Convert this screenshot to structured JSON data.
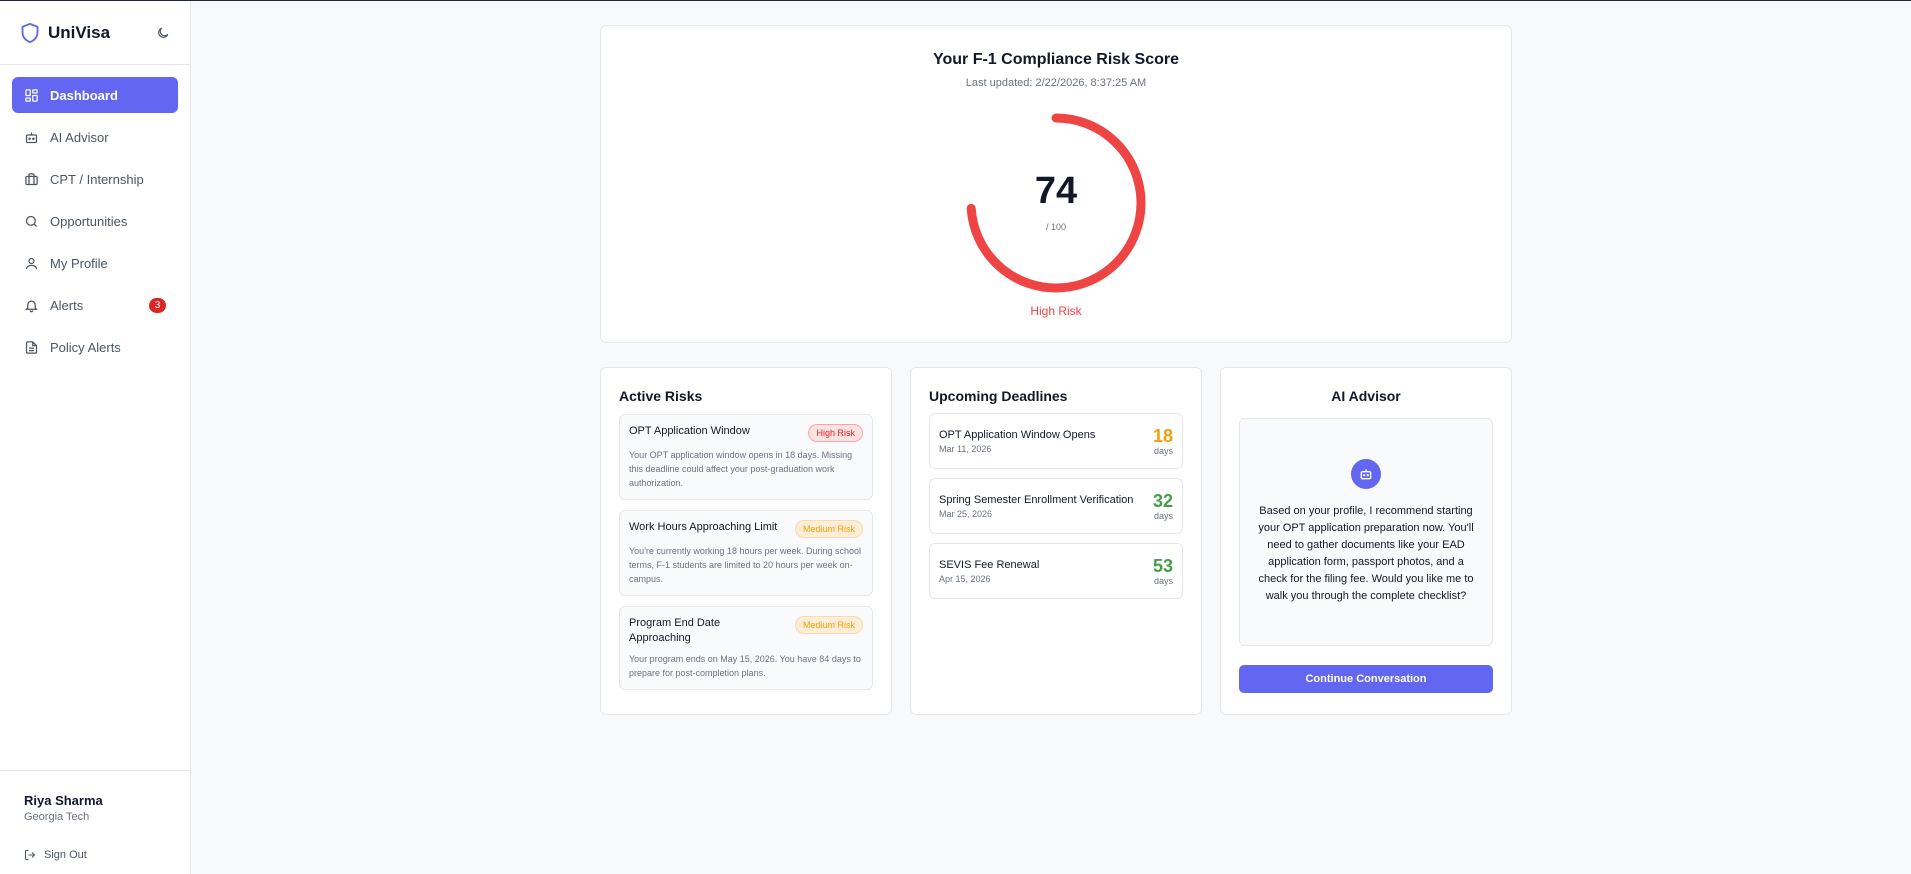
{
  "app": {
    "name": "UniVisa"
  },
  "nav": [
    {
      "label": "Dashboard",
      "icon": "dashboard-icon",
      "active": true
    },
    {
      "label": "AI Advisor",
      "icon": "bot-icon"
    },
    {
      "label": "CPT / Internship",
      "icon": "briefcase-icon"
    },
    {
      "label": "Opportunities",
      "icon": "search-icon"
    },
    {
      "label": "My Profile",
      "icon": "user-icon"
    },
    {
      "label": "Alerts",
      "icon": "bell-icon",
      "badge": "3"
    },
    {
      "label": "Policy Alerts",
      "icon": "document-icon"
    }
  ],
  "user": {
    "name": "Riya Sharma",
    "school": "Georgia Tech",
    "signout_label": "Sign Out"
  },
  "score": {
    "title": "Your F-1 Compliance Risk Score",
    "updated": "Last updated: 2/22/2026, 8:37:25 AM",
    "value": "74",
    "max": "/ 100",
    "level": "High Risk",
    "color": "#ef4444"
  },
  "risks": {
    "title": "Active Risks",
    "items": [
      {
        "title": "OPT Application Window",
        "badge": "High Risk",
        "desc": "Your OPT application window opens in 18 days. Missing this deadline could affect your post-graduation work authorization."
      },
      {
        "title": "Work Hours Approaching Limit",
        "badge": "Medium Risk",
        "desc": "You're currently working 18 hours per week. During school terms, F-1 students are limited to 20 hours per week on-campus."
      },
      {
        "title": "Program End Date Approaching",
        "badge": "Medium Risk",
        "desc": "Your program ends on May 15, 2026. You have 84 days to prepare for post-completion plans."
      }
    ]
  },
  "deadlines": {
    "title": "Upcoming Deadlines",
    "unit": "days",
    "items": [
      {
        "name": "OPT Application Window Opens",
        "date": "Mar 11, 2026",
        "days": "18",
        "color": "#f59e0b"
      },
      {
        "name": "Spring Semester Enrollment Verification",
        "date": "Mar 25, 2026",
        "days": "32",
        "color": "#43a047"
      },
      {
        "name": "SEVIS Fee Renewal",
        "date": "Apr 15, 2026",
        "days": "53",
        "color": "#43a047"
      }
    ]
  },
  "advisor": {
    "title": "AI Advisor",
    "message": "Based on your profile, I recommend starting your OPT application preparation now. You'll need to gather documents like your EAD application form, passport photos, and a check for the filing fee. Would you like me to walk you through the complete checklist?",
    "button_label": "Continue Conversation"
  }
}
